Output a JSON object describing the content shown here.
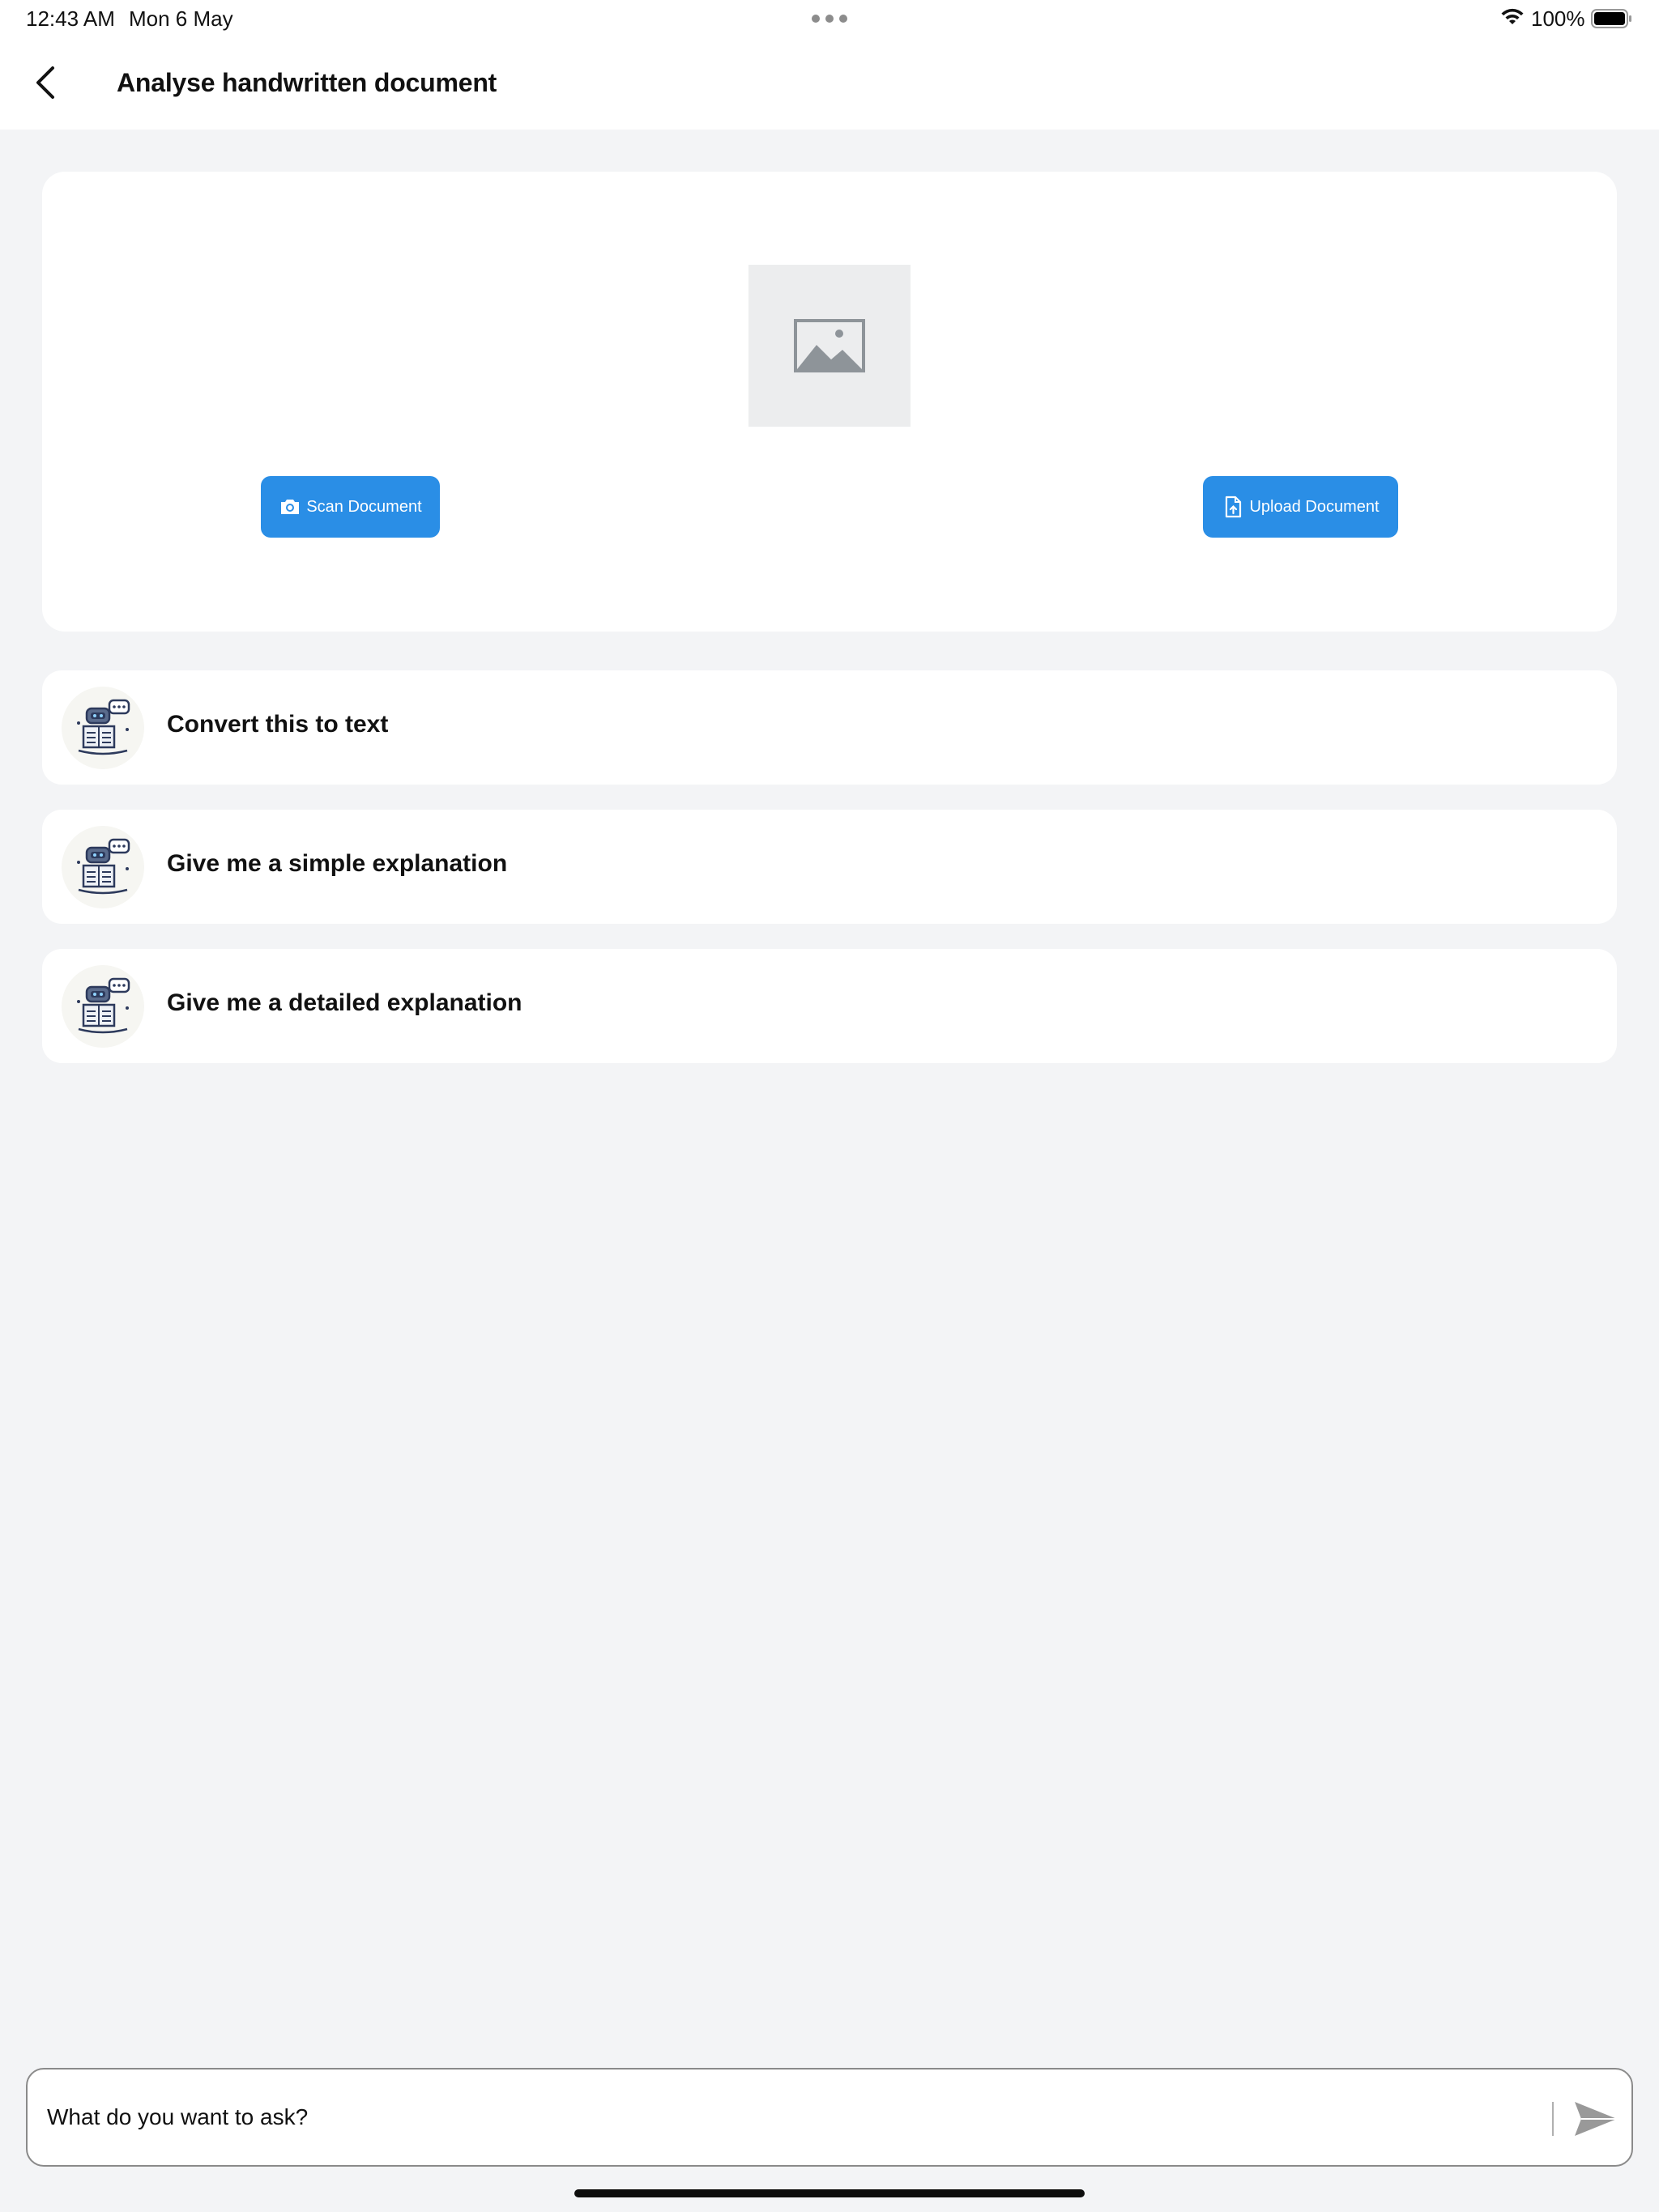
{
  "status_bar": {
    "time": "12:43 AM",
    "date": "Mon 6 May",
    "battery": "100%",
    "icons": [
      "multitasking-dots-icon",
      "wifi-icon",
      "battery-icon"
    ]
  },
  "header": {
    "title": "Analyse handwritten document",
    "back_icon": "chevron-left-icon"
  },
  "upload_card": {
    "placeholder_icon": "image-placeholder-icon",
    "scan_label": "Scan Document",
    "scan_icon": "camera-icon",
    "upload_label": "Upload Document",
    "upload_icon": "file-upload-icon",
    "button_color": "#2a8ee6"
  },
  "suggestions": [
    {
      "label": "Convert this to text",
      "icon": "robot-reading-icon"
    },
    {
      "label": "Give me a simple explanation",
      "icon": "robot-reading-icon"
    },
    {
      "label": "Give me a detailed explanation",
      "icon": "robot-reading-icon"
    }
  ],
  "ask_bar": {
    "placeholder": "What do you want to ask?",
    "value": "",
    "send_icon": "send-icon"
  },
  "colors": {
    "background": "#f3f4f6",
    "card": "#ffffff",
    "accent": "#2a8ee6"
  }
}
